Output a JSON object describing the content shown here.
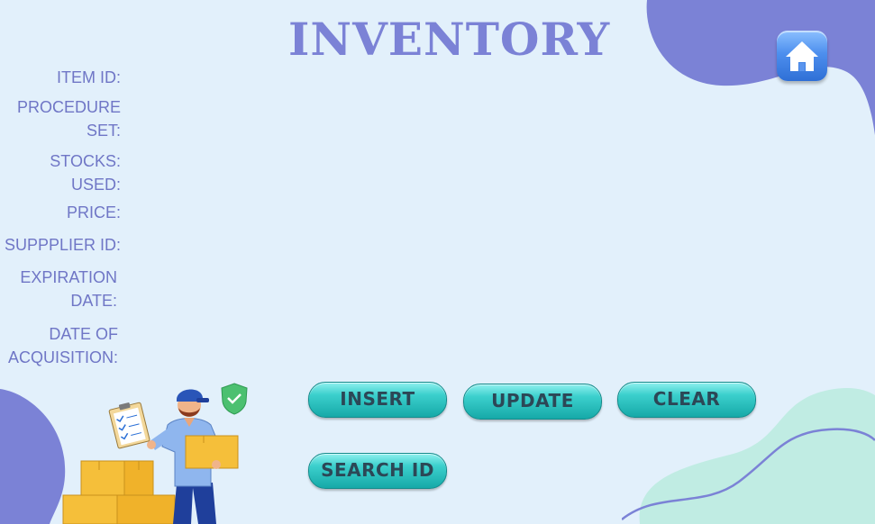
{
  "page": {
    "title": "INVENTORY"
  },
  "form": {
    "labels": {
      "item_id": "ITEM ID:",
      "procedure_set_1": "PROCEDURE",
      "procedure_set_2": "SET:",
      "stocks_used_1": "STOCKS:",
      "stocks_used_2": "USED:",
      "price": "PRICE:",
      "supplier_id": "SUPPPLIER ID:",
      "expiration_1": "EXPIRATION",
      "expiration_2": "DATE:",
      "acquisition_1": "DATE OF",
      "acquisition_2": "ACQUISITION:"
    }
  },
  "buttons": {
    "insert": "INSERT",
    "update": "UPDATE",
    "clear": "CLEAR",
    "search_id": "SEARCH ID"
  },
  "icons": {
    "home": "home-icon",
    "shield": "shield-check-icon"
  },
  "colors": {
    "background": "#e2f0fb",
    "accent_purple": "#7b82d6",
    "label_text": "#6f76c6",
    "button_teal": "#2ec4c1",
    "mint": "#c0ece3"
  }
}
